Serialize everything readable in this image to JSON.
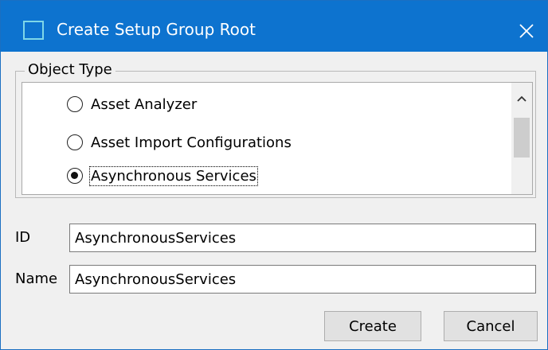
{
  "window": {
    "title": "Create Setup Group Root",
    "title_bar_color": "#0d73cf",
    "app_icon": "window-square-icon",
    "close_icon": "close-x-icon"
  },
  "object_type": {
    "legend": "Object Type",
    "options": [
      {
        "label": "Asset Analyzer",
        "checked": false
      },
      {
        "label": "Asset Import Configurations",
        "checked": false
      },
      {
        "label": "Asynchronous Services",
        "checked": true
      }
    ],
    "scroll_up_icon": "chevron-up-icon"
  },
  "form": {
    "id_label": "ID",
    "id_value": "AsynchronousServices",
    "name_label": "Name",
    "name_value": "AsynchronousServices"
  },
  "buttons": {
    "create_label": "Create",
    "cancel_label": "Cancel"
  }
}
